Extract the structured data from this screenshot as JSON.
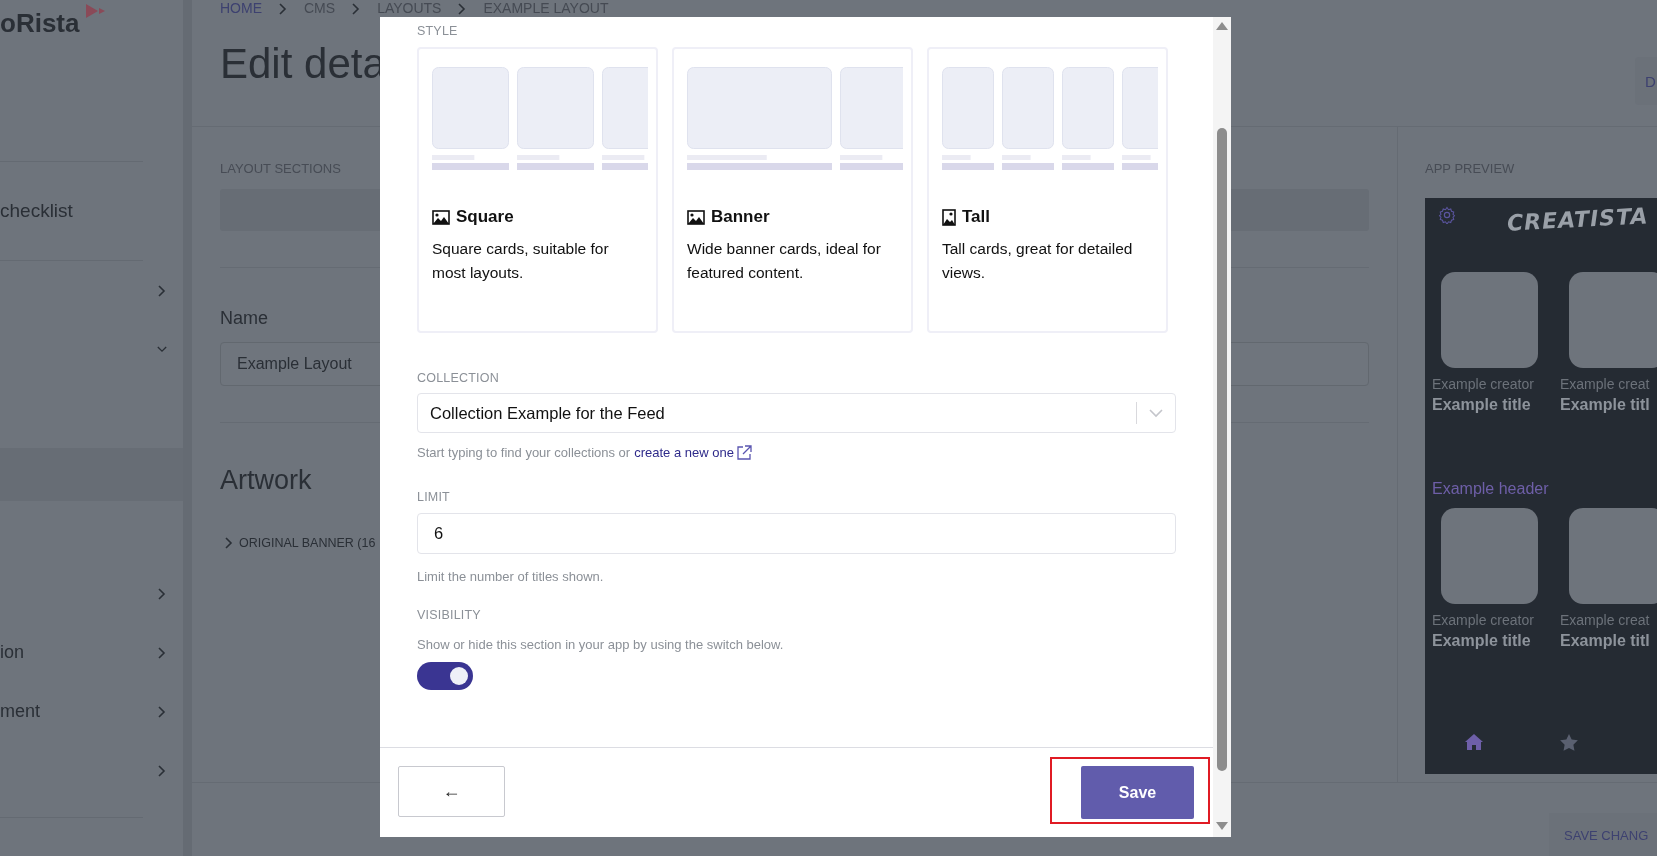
{
  "sidebar": {
    "logo": "oRista",
    "items": [
      {
        "kind": "link",
        "label": "checklist",
        "selected": false
      },
      {
        "kind": "group",
        "selected": false,
        "expanded": false
      },
      {
        "kind": "group",
        "selected": false,
        "expanded": true
      },
      {
        "kind": "link",
        "selected": true
      },
      {
        "kind": "group",
        "selected": false,
        "expanded": false
      },
      {
        "kind": "group",
        "label": "ion",
        "selected": false,
        "expanded": false
      },
      {
        "kind": "group",
        "label": "ment",
        "selected": false,
        "expanded": false
      },
      {
        "kind": "group",
        "selected": false,
        "expanded": false
      }
    ]
  },
  "main": {
    "breadcrumb": [
      "HOME",
      "CMS",
      "LAYOUTS",
      "EXAMPLE LAYOUT"
    ],
    "title": "Edit deta",
    "top_button": "D",
    "layout_sections_label": "LAYOUT SECTIONS",
    "name_label": "Name",
    "name_value": "Example Layout",
    "artwork_title": "Artwork",
    "artwork_items": [
      {
        "label": "ORIGINAL BANNER (16",
        "expanded": false
      }
    ],
    "save_changes": "SAVE CHANG"
  },
  "preview": {
    "label": "APP PREVIEW",
    "app_title": "CREATISTA",
    "sections": [
      {
        "cards": [
          {
            "creator": "Example creator",
            "title": "Example title"
          },
          {
            "creator": "Example creat",
            "title": "Example titl"
          }
        ]
      },
      {
        "header": "Example header",
        "cards": [
          {
            "creator": "Example creator",
            "title": "Example title"
          },
          {
            "creator": "Example creat",
            "title": "Example titl"
          }
        ]
      }
    ],
    "nav": [
      {
        "kind": "home",
        "selected": true
      },
      {
        "kind": "star",
        "selected": false
      }
    ]
  },
  "modal": {
    "style_label": "STYLE",
    "styles": [
      {
        "kind": "square",
        "title": "Square",
        "description": "Square cards, suitable for most layouts."
      },
      {
        "kind": "banner",
        "title": "Banner",
        "description": "Wide banner cards, ideal for featured content."
      },
      {
        "kind": "tall",
        "title": "Tall",
        "description": "Tall cards, great for detailed views."
      }
    ],
    "collection": {
      "label": "COLLECTION",
      "value": "Collection Example for the Feed",
      "help": "Start typing to find your collections or ",
      "link": "create a new one"
    },
    "limit": {
      "label": "LIMIT",
      "value": "6",
      "help": "Limit the number of titles shown."
    },
    "visibility": {
      "label": "VISIBILITY",
      "help": "Show or hide this section in your app by using the switch below.",
      "on": true
    },
    "back_button": "←",
    "save_button": {
      "label": "Save",
      "highlighted": true
    }
  }
}
